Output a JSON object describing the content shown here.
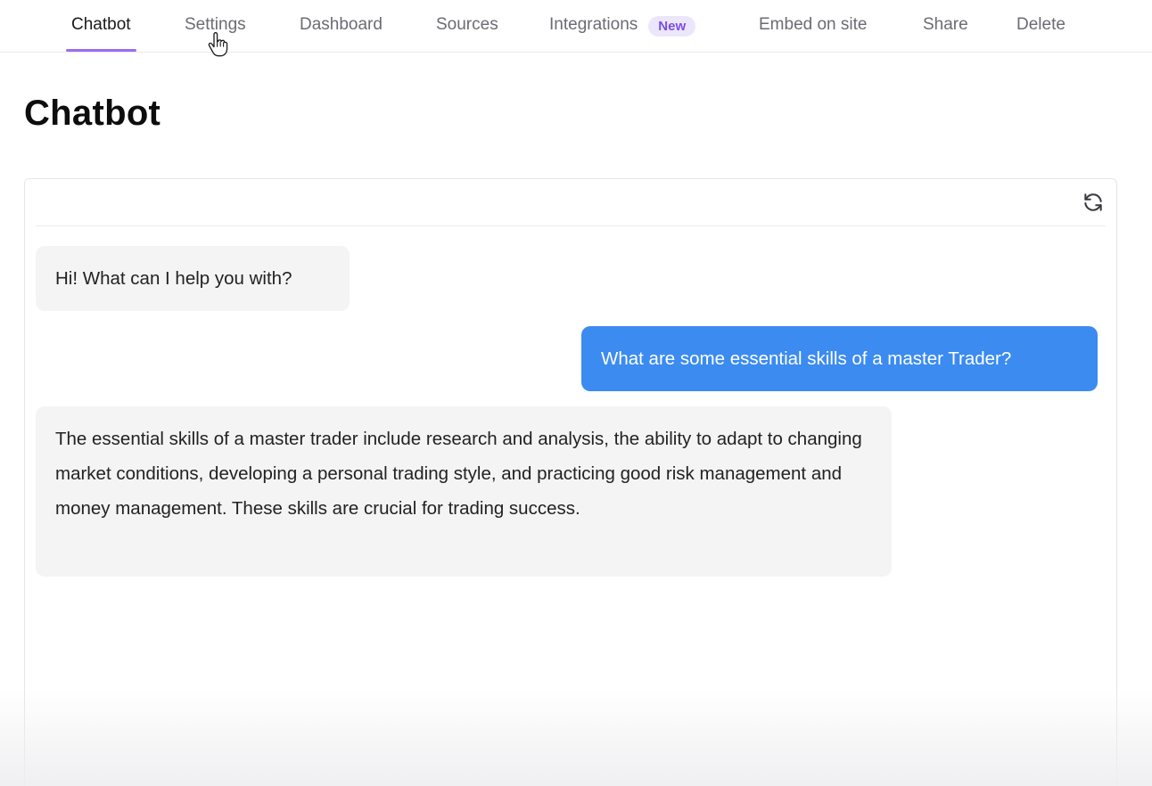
{
  "nav": {
    "tabs": [
      {
        "label": "Chatbot",
        "active": true
      },
      {
        "label": "Settings",
        "active": false
      },
      {
        "label": "Dashboard",
        "active": false
      },
      {
        "label": "Sources",
        "active": false
      },
      {
        "label": "Integrations",
        "active": false,
        "badge": "New"
      },
      {
        "label": "Embed on site",
        "active": false
      },
      {
        "label": "Share",
        "active": false
      },
      {
        "label": "Delete",
        "active": false
      }
    ],
    "accent_color": "#9d6cf0"
  },
  "page": {
    "title": "Chatbot"
  },
  "chat": {
    "refresh_icon": "refresh-icon",
    "user_bubble_color": "#3b8bf1",
    "bot_bubble_color": "#f4f4f5",
    "messages": [
      {
        "role": "bot",
        "text": "Hi! What can I help you with?"
      },
      {
        "role": "user",
        "text": "What are some essential skills of a master Trader?"
      },
      {
        "role": "bot",
        "text": "The essential skills of a master trader include research and analysis, the ability to adapt to changing market conditions, developing a personal trading style, and practicing good risk management and money management. These skills are crucial for trading success."
      }
    ]
  }
}
